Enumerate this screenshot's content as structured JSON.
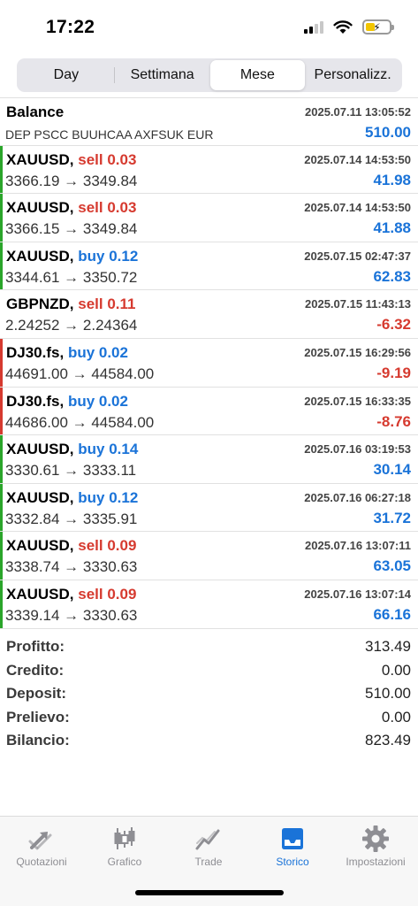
{
  "status_bar": {
    "time": "17:22"
  },
  "segments": [
    "Day",
    "Settimana",
    "Mese",
    "Personalizz."
  ],
  "active_segment": "Mese",
  "balance": {
    "title": "Balance",
    "description": "DEP PSCC BUUHCAA AXFSUK EUR",
    "date": "2025.07.11 13:05:52",
    "amount": "510.00"
  },
  "trades": [
    {
      "symbol": "XAUUSD,",
      "side": "sell 0.03",
      "prices": "3366.19 → 3349.84",
      "date": "2025.07.14 14:53:50",
      "profit": "41.98",
      "side_color": "#d63a2f",
      "profit_color": "#1a73d8",
      "bar_color": "#2aa52a"
    },
    {
      "symbol": "XAUUSD,",
      "side": "sell 0.03",
      "prices": "3366.15 → 3349.84",
      "date": "2025.07.14 14:53:50",
      "profit": "41.88",
      "side_color": "#d63a2f",
      "profit_color": "#1a73d8",
      "bar_color": "#2aa52a"
    },
    {
      "symbol": "XAUUSD,",
      "side": "buy 0.12",
      "prices": "3344.61 → 3350.72",
      "date": "2025.07.15 02:47:37",
      "profit": "62.83",
      "side_color": "#1a73d8",
      "profit_color": "#1a73d8",
      "bar_color": "#2aa52a"
    },
    {
      "symbol": "GBPNZD,",
      "side": "sell 0.11",
      "prices": "2.24252 → 2.24364",
      "date": "2025.07.15 11:43:13",
      "profit": "-6.32",
      "side_color": "#d63a2f",
      "profit_color": "#d63a2f",
      "bar_color": "#ffffff"
    },
    {
      "symbol": "DJ30.fs,",
      "side": "buy 0.02",
      "prices": "44691.00 → 44584.00",
      "date": "2025.07.15 16:29:56",
      "profit": "-9.19",
      "side_color": "#1a73d8",
      "profit_color": "#d63a2f",
      "bar_color": "#d63a2f"
    },
    {
      "symbol": "DJ30.fs,",
      "side": "buy 0.02",
      "prices": "44686.00 → 44584.00",
      "date": "2025.07.15 16:33:35",
      "profit": "-8.76",
      "side_color": "#1a73d8",
      "profit_color": "#d63a2f",
      "bar_color": "#d63a2f"
    },
    {
      "symbol": "XAUUSD,",
      "side": "buy 0.14",
      "prices": "3330.61 → 3333.11",
      "date": "2025.07.16 03:19:53",
      "profit": "30.14",
      "side_color": "#1a73d8",
      "profit_color": "#1a73d8",
      "bar_color": "#2aa52a"
    },
    {
      "symbol": "XAUUSD,",
      "side": "buy 0.12",
      "prices": "3332.84 → 3335.91",
      "date": "2025.07.16 06:27:18",
      "profit": "31.72",
      "side_color": "#1a73d8",
      "profit_color": "#1a73d8",
      "bar_color": "#2aa52a"
    },
    {
      "symbol": "XAUUSD,",
      "side": "sell 0.09",
      "prices": "3338.74 → 3330.63",
      "date": "2025.07.16 13:07:11",
      "profit": "63.05",
      "side_color": "#d63a2f",
      "profit_color": "#1a73d8",
      "bar_color": "#2aa52a"
    },
    {
      "symbol": "XAUUSD,",
      "side": "sell 0.09",
      "prices": "3339.14 → 3330.63",
      "date": "2025.07.16 13:07:14",
      "profit": "66.16",
      "side_color": "#d63a2f",
      "profit_color": "#1a73d8",
      "bar_color": "#2aa52a"
    }
  ],
  "summary": [
    {
      "label": "Profitto:",
      "value": "313.49"
    },
    {
      "label": "Credito:",
      "value": "0.00"
    },
    {
      "label": "Deposit:",
      "value": "510.00"
    },
    {
      "label": "Prelievo:",
      "value": "0.00"
    },
    {
      "label": "Bilancio:",
      "value": "823.49"
    }
  ],
  "tabs": [
    {
      "label": "Quotazioni",
      "icon": "quotes-arrows-icon"
    },
    {
      "label": "Grafico",
      "icon": "candlestick-chart-icon"
    },
    {
      "label": "Trade",
      "icon": "trade-line-icon"
    },
    {
      "label": "Storico",
      "icon": "history-tray-icon"
    },
    {
      "label": "Impostazioni",
      "icon": "gear-icon"
    }
  ],
  "active_tab": "Storico",
  "colors": {
    "accent": "#1a73d8",
    "loss": "#d63a2f",
    "win_bar": "#2aa52a",
    "tab_inactive": "#8e8e93"
  }
}
